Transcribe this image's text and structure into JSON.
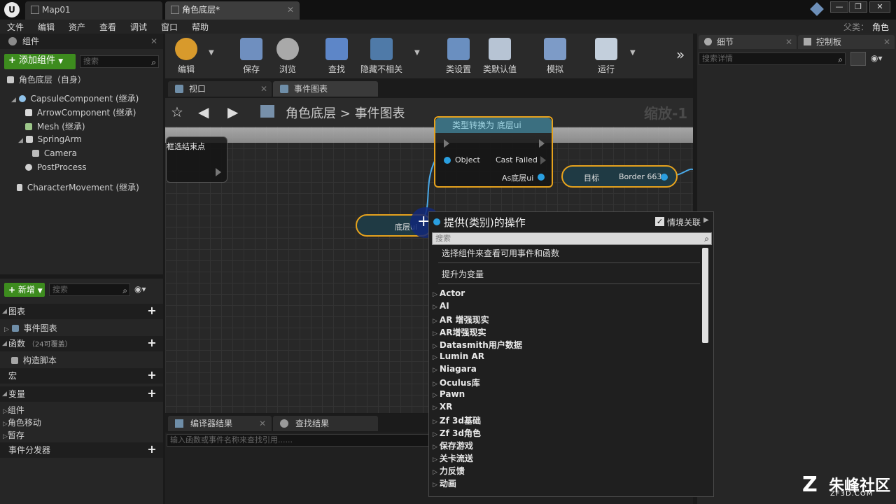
{
  "titlebar": {
    "tabs": [
      {
        "label": "Map01"
      },
      {
        "label": "角色底层*"
      }
    ],
    "controls": {
      "minimize": "—",
      "maximize": "❐",
      "close": "✕"
    }
  },
  "menu": {
    "items": [
      "文件",
      "编辑",
      "资产",
      "查看",
      "调试",
      "窗口",
      "帮助"
    ],
    "parent_label": "父类：",
    "parent_value": "角色"
  },
  "components_panel": {
    "title": "组件",
    "add_button": "添加组件",
    "search_placeholder": "搜索",
    "self_item": "角色底层（自身）",
    "tree": [
      {
        "label": "CapsuleComponent (继承)"
      },
      {
        "label": "ArrowComponent (继承)"
      },
      {
        "label": "Mesh (继承)"
      },
      {
        "label": "SpringArm"
      },
      {
        "label": "Camera"
      },
      {
        "label": "PostProcess"
      },
      {
        "label": "CharacterMovement (继承)"
      }
    ]
  },
  "mybp_panel": {
    "new_button": "新增",
    "search_placeholder": "搜索",
    "sections": {
      "graphs": "图表",
      "event_graph": "事件图表",
      "functions": "函数",
      "functions_count": "（24可覆盖）",
      "construction_script": "构造脚本",
      "macros": "宏",
      "variables": "变量",
      "var_components": "组件",
      "var_movement": "角色移动",
      "var_temp": "暂存",
      "event_dispatchers": "事件分发器"
    }
  },
  "toolbar": {
    "buttons": [
      {
        "label": "编辑"
      },
      {
        "label": "保存"
      },
      {
        "label": "浏览"
      },
      {
        "label": "查找"
      },
      {
        "label": "隐藏不相关"
      },
      {
        "label": "类设置"
      },
      {
        "label": "类默认值"
      },
      {
        "label": "模拟"
      },
      {
        "label": "运行"
      }
    ],
    "overflow": "»"
  },
  "graph_tabs": [
    {
      "label": "视口"
    },
    {
      "label": "事件图表"
    }
  ],
  "breadcrumb": {
    "root": "角色底层",
    "separator": ">",
    "current": "事件图表",
    "zoom": "缩放-1"
  },
  "nodes": {
    "left_node_title": "框选结束点",
    "cast_node": {
      "title": "类型转换为 底层ui",
      "object_pin": "Object",
      "cast_failed_pin": "Cast Failed",
      "as_pin": "As底层ui"
    },
    "set_node": {
      "target": "目标",
      "value": "Border 663"
    },
    "var_node": "底层ui"
  },
  "context_menu": {
    "title": "提供(类别)的操作",
    "context_sensitive": "情境关联",
    "search_placeholder": "搜索",
    "options": [
      "选择组件来查看可用事件和函数",
      "提升为变量"
    ],
    "categories": [
      "Actor",
      "AI",
      "AR 增强现实",
      "AR增强现实",
      "Datasmith用户数据",
      "Lumin AR",
      "Niagara",
      "Oculus库",
      "Pawn",
      "XR",
      "Zf 3d基础",
      "Zf 3d角色",
      "保存游戏",
      "关卡流送",
      "力反馈",
      "动画"
    ]
  },
  "bottom_tabs": [
    {
      "label": "编译器结果"
    },
    {
      "label": "查找结果"
    }
  ],
  "find_placeholder": "输入函数或事件名称来查找引用......",
  "right_panel": {
    "tabs": [
      {
        "label": "细节"
      },
      {
        "label": "控制板"
      }
    ],
    "search_placeholder": "搜索详情"
  },
  "watermark": {
    "logo": "Z",
    "text": "朱峰社区",
    "url": "ZF3D.COM"
  }
}
